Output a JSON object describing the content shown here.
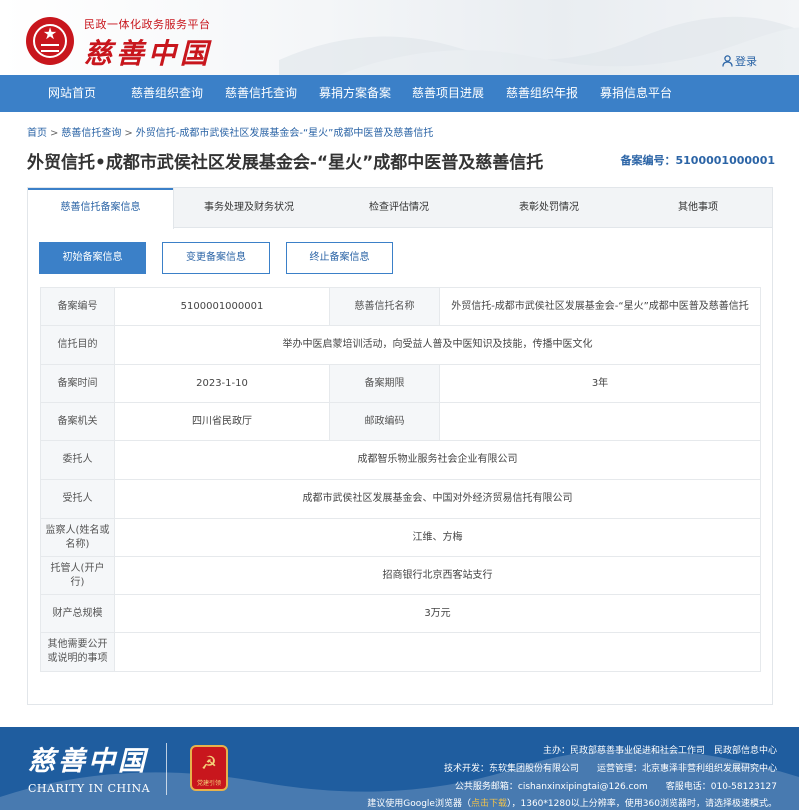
{
  "header": {
    "subtitle": "民政一体化政务服务平台",
    "title": "慈善中国",
    "login": "登录"
  },
  "nav": [
    "网站首页",
    "慈善组织查询",
    "慈善信托查询",
    "募捐方案备案",
    "慈善项目进展",
    "慈善组织年报",
    "募捐信息平台"
  ],
  "breadcrumb": [
    "首页",
    "慈善信托查询",
    "外贸信托-成都市武侯社区发展基金会-“星火”成都中医普及慈善信托"
  ],
  "page": {
    "title": "外贸信托•成都市武侯社区发展基金会-“星火”成都中医普及慈善信托",
    "record_no": "备案编号：5100001000001"
  },
  "tabs": [
    "慈善信托备案信息",
    "事务处理及财务状况",
    "检查评估情况",
    "表彰处罚情况",
    "其他事项"
  ],
  "sub_buttons": [
    "初始备案信息",
    "变更备案信息",
    "终止备案信息"
  ],
  "table": {
    "record_no_label": "备案编号",
    "record_no": "5100001000001",
    "trust_name_label": "慈善信托名称",
    "trust_name": "外贸信托-成都市武侯社区发展基金会-“星火”成都中医普及慈善信托",
    "purpose_label": "信托目的",
    "purpose": "举办中医启蒙培训活动，向受益人普及中医知识及技能，传播中医文化",
    "time_label": "备案时间",
    "time": "2023-1-10",
    "term_label": "备案期限",
    "term": "3年",
    "authority_label": "备案机关",
    "authority": "四川省民政厅",
    "postcode_label": "邮政编码",
    "postcode": "",
    "settlor_label": "委托人",
    "settlor": "成都智乐物业服务社会企业有限公司",
    "trustee_label": "受托人",
    "trustee": "成都市武侯社区发展基金会、中国对外经济贸易信托有限公司",
    "supervisor_label": "监察人(姓名或名称)",
    "supervisor": "江维、方梅",
    "custodian_label": "托管人(开户行)",
    "custodian": "招商银行北京西客站支行",
    "assets_label": "财产总规模",
    "assets": "3万元",
    "other_label": "其他需要公开或说明的事项",
    "other": ""
  },
  "footer": {
    "logo": "慈善中国",
    "logo_en": "CHARITY IN CHINA",
    "badge": "党建引领",
    "line1": "主办：民政部慈善事业促进和社会工作司　民政部信息中心",
    "line2": "技术开发：东软集团股份有限公司　　运营管理：北京惠泽非营利组织发展研究中心",
    "line3": "公共服务邮箱：cishanxinxipingtai@126.com　　客服电话：010-58123127",
    "line4_a": "建议使用Google浏览器（",
    "line4_b": "点击下载",
    "line4_c": "），1360*1280以上分辨率，使用360浏览器时，请选择极速模式。"
  },
  "colors": {
    "brand_red": "#c8161d",
    "primary_blue": "#3b80c8",
    "footer_blue": "#1f5d9f"
  }
}
